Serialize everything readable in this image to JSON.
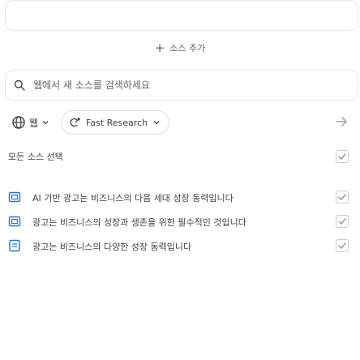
{
  "add_source_label": "소스 추가",
  "search": {
    "placeholder": "웹에서 새 소스를 검색하세요"
  },
  "filter": {
    "source_type_label": "웹",
    "research_chip_label": "Fast Research"
  },
  "select_all_label": "모든 소스 선택",
  "sources": [
    {
      "title": "AI 기반 광고는 비즈니스의 다음 세대 성장 동력입니다",
      "icon": "slides-icon"
    },
    {
      "title": "광고는 비즈니스의 성장과 생존을 위한 필수적인 것입니다",
      "icon": "slides-icon"
    },
    {
      "title": "광고는 비즈니스의 다양한 성장 동력입니다",
      "icon": "document-icon"
    }
  ],
  "colors": {
    "accent": "#1a73e8",
    "check_gray": "#9aa0a6",
    "icon_blue": "#1a73e8"
  }
}
